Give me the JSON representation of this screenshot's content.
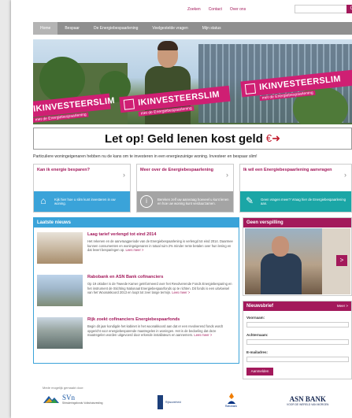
{
  "toplinks": [
    "Zoeken",
    "Contact",
    "Over ons"
  ],
  "search": {
    "button": "Q"
  },
  "nav": [
    "Home",
    "Bespaar",
    "De Energiebespaarlening",
    "Veelgestelde vragen",
    "Mijn status"
  ],
  "banner": {
    "campaign_left": "IKINVESTEERSLIM",
    "campaign_mid": "IKINVESTEERSLIM",
    "campaign_right": "IKINVESTEERSLIM",
    "campaign_sub": "met de Energiebespaarlening"
  },
  "headline": {
    "text": "Let op! Geld lenen kost geld",
    "icon": "walking-man-icon"
  },
  "intro": "Particuliere woningeigenaren hebben nu de kans om te investeren in een energiezuinige woning. Investeer en bespaar slim!",
  "cards": [
    {
      "title": "Kan ik energie besparen?",
      "body": "Kijk hier hoe u slim kunt investeren in uw woning.",
      "color": "#3aa3d9"
    },
    {
      "title": "Meer over de Energiebespaarlening",
      "body": "Bereken zelf uw aanvraag hoeveel u kunt lenen en hoe uw woning kunt verduurzamen.",
      "color": "#a4a4a4"
    },
    {
      "title": "Ik wil een Energiebespaarlening aanvragen",
      "body": "Geen vragen meer? Vraag hier de Energiebespaarlening aan.",
      "color": "#1ba6a6"
    }
  ],
  "news": {
    "heading": "Laatste nieuws",
    "more": "Lees meer >",
    "items": [
      {
        "title": "Laag tarief verlengd tot eind 2014",
        "body": "Het rekenen en de aanvraagperiode van de Energiebespaarlening is verlengd tot eind 2014. Daarmee kunnen consumenten en woningeigenaren in totaal ruim 2% minder rente betalen over hun lening en dat levert besparingen op."
      },
      {
        "title": "Rabobank en ASN Bank cofinanciers",
        "body": "Op 19 oktober is de Tweede Kamer geïnformeerd over het Revolverende Fonds Energiebesparing en het instrument de Stichting Nationaal Energiebespaarfonds op te richten. Dit fonds is een uitvloeisel van het Woonakkoord 2013 en loopt tot zeer lange termijn."
      },
      {
        "title": "Rijk zoekt cofinanciers Energiebespaarfonds",
        "body": "Begin dit jaar kondigde het kabinet in het woonakkoord aan dat er een revolverend fonds wordt opgericht voor energiebesparende maatregelen in woningen. Het is de bedoeling dat deze maatregelen worden uitgevoerd door erkende installateurs en aannemers."
      }
    ]
  },
  "promo": {
    "heading": "Geen verspilling",
    "arrow": ">"
  },
  "newsletter": {
    "heading": "Nieuwsbrief",
    "more": "Meer >",
    "fields": [
      "Voornaam:",
      "Achternaam:",
      "E-mailadres:"
    ],
    "button": "Aanmelden"
  },
  "footer": {
    "made": "Mede mogelijk gemaakt door:",
    "svn_name": "SVn",
    "svn_sub": "Stimuleringsfonds Volkshuisvesting",
    "rijk_sub": "Rijksoverheid",
    "rabo_sub": "Rabobank",
    "asn_name": "ASN BANK",
    "asn_sub": "VOOR DE WERELD VAN MORGEN"
  },
  "colors": {
    "brand": "#a3195b",
    "blue": "#3aa3d9",
    "teal": "#1ba6a6",
    "gray": "#a4a4a4"
  }
}
